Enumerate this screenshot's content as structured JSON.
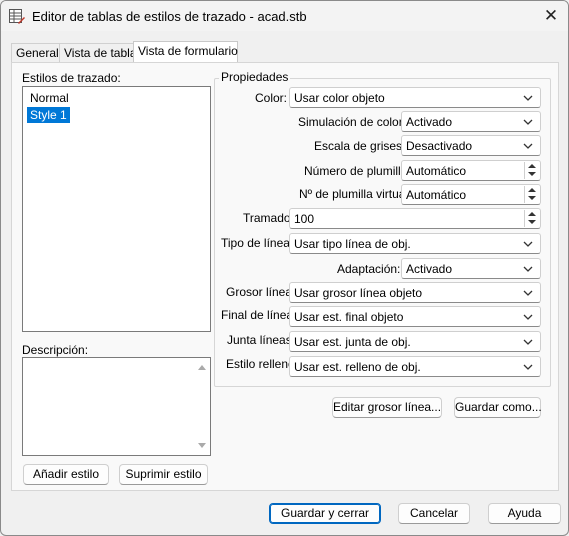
{
  "window": {
    "title": "Editor de tablas de estilos de trazado - acad.stb",
    "close_glyph": "✕"
  },
  "tabs": [
    {
      "label": "General"
    },
    {
      "label": "Vista de tabla"
    },
    {
      "label": "Vista de formulario",
      "active": true
    }
  ],
  "styles": {
    "label": "Estilos de trazado:",
    "items": [
      {
        "label": "Normal",
        "selected": false
      },
      {
        "label": "Style 1",
        "selected": true
      }
    ]
  },
  "description": {
    "label": "Descripción:",
    "value": ""
  },
  "buttons_left": {
    "add": "Añadir estilo",
    "delete": "Suprimir estilo"
  },
  "properties": {
    "title": "Propiedades",
    "color": {
      "label": "Color:",
      "value": "Usar color objeto"
    },
    "dither": {
      "label": "Simulación de color:",
      "value": "Activado"
    },
    "grayscale": {
      "label": "Escala de grises:",
      "value": "Desactivado"
    },
    "pen_number": {
      "label": "Número de plumilla:",
      "value": "Automático"
    },
    "virtual_pen": {
      "label": "Nº de plumilla virtual:",
      "value": "Automático"
    },
    "screening": {
      "label": "Tramado:",
      "value": "100"
    },
    "linetype": {
      "label": "Tipo de línea:",
      "value": "Usar tipo línea de obj."
    },
    "adaptive": {
      "label": "Adaptación:",
      "value": "Activado"
    },
    "lineweight": {
      "label": "Grosor línea:",
      "value": "Usar grosor línea objeto"
    },
    "line_end": {
      "label": "Final de línea:",
      "value": "Usar est. final objeto"
    },
    "line_join": {
      "label": "Junta líneas:",
      "value": "Usar est. junta de obj."
    },
    "fill_style": {
      "label": "Estilo relleno:",
      "value": "Usar est. relleno de obj."
    }
  },
  "buttons_right": {
    "edit_lineweights": "Editar grosor línea...",
    "save_as": "Guardar como..."
  },
  "footer": {
    "save_close": "Guardar y cerrar",
    "cancel": "Cancelar",
    "help": "Ayuda"
  },
  "icons": {
    "app": "plot-style-table-icon",
    "close": "close-icon",
    "dropdown": "chevron-down-icon"
  },
  "colors": {
    "selection": "#0078d7",
    "default_button_border": "#0067c0"
  }
}
